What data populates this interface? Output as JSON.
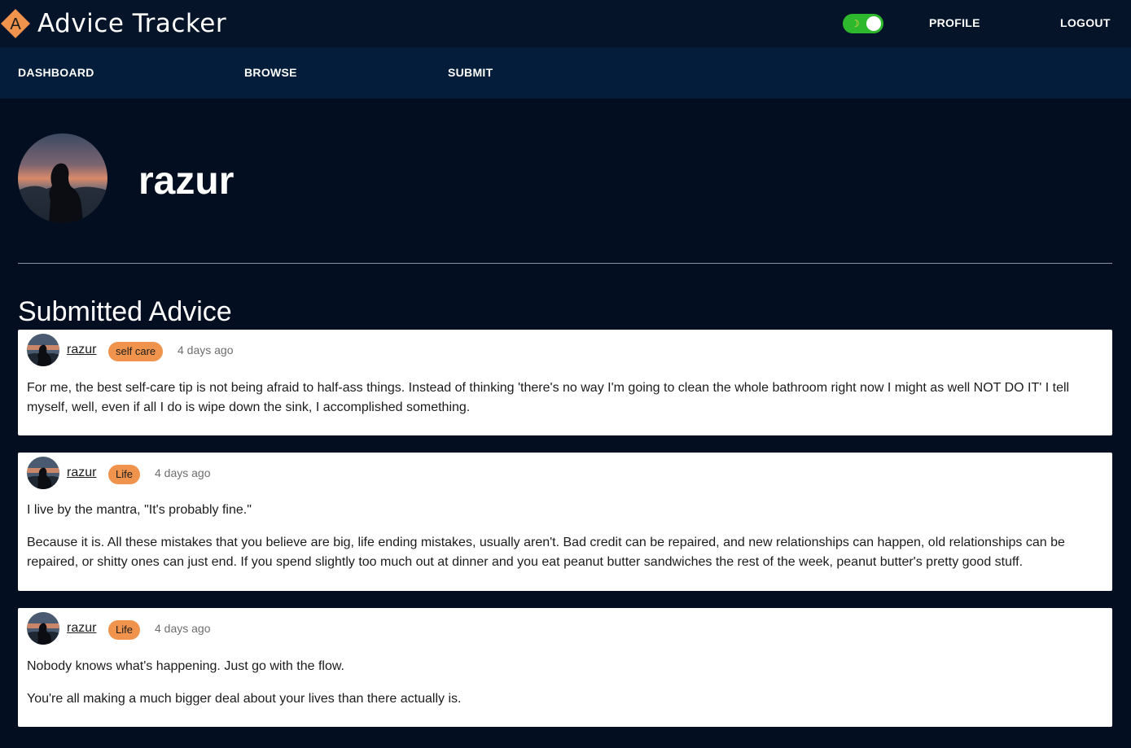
{
  "header": {
    "logo_letter": "A",
    "app_title": "Advice Tracker",
    "theme_toggle": {
      "on": true,
      "icon": "moon-icon"
    },
    "links": [
      "PROFILE",
      "LOGOUT"
    ]
  },
  "nav": {
    "items": [
      "DASHBOARD",
      "BROWSE",
      "SUBMIT"
    ]
  },
  "profile": {
    "username": "razur",
    "avatar": "silhouette-sunset-avatar"
  },
  "section": {
    "title": "Submitted Advice"
  },
  "posts": [
    {
      "author": "razur",
      "tag": "self care",
      "time": "4 days ago",
      "paragraphs": [
        "For me, the best self-care tip is not being afraid to half-ass things. Instead of thinking 'there's no way I'm going to clean the whole bathroom right now I might as well NOT DO IT' I tell myself, well, even if all I do is wipe down the sink, I accomplished something."
      ]
    },
    {
      "author": "razur",
      "tag": "Life",
      "time": "4 days ago",
      "paragraphs": [
        "I live by the mantra, \"It's probably fine.\"",
        "Because it is. All these mistakes that you believe are big, life ending mistakes, usually aren't. Bad credit can be repaired, and new relationships can happen, old relationships can be repaired, or shitty ones can just end. If you spend slightly too much out at dinner and you eat peanut butter sandwiches the rest of the week, peanut butter's pretty good stuff."
      ]
    },
    {
      "author": "razur",
      "tag": "Life",
      "time": "4 days ago",
      "paragraphs": [
        "Nobody knows what's happening. Just go with the flow.",
        "You're all making a much bigger deal about your lives than there actually is."
      ]
    }
  ],
  "colors": {
    "background": "#030f20",
    "topbar": "#051428",
    "navbar": "#031d3b",
    "tag": "#f0944d",
    "toggle_on": "#2eb82e",
    "logo": "#f0944d"
  }
}
